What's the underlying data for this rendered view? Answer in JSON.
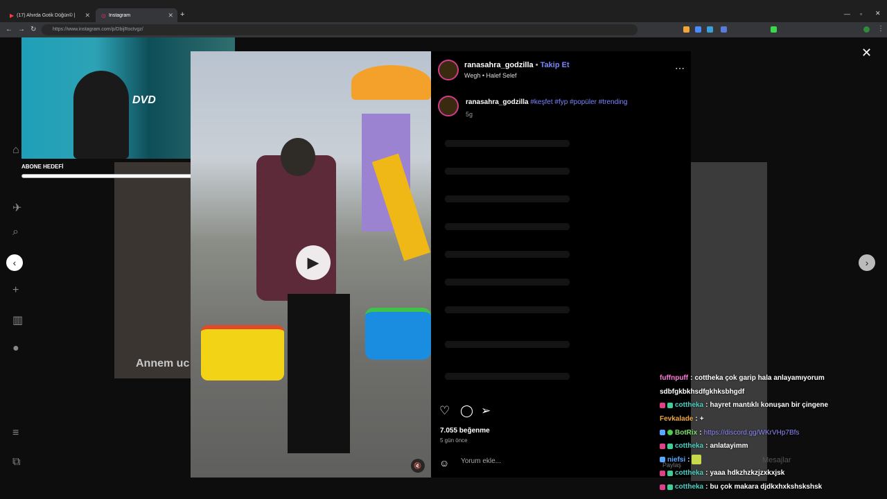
{
  "tabs": [
    {
      "label": "(17) Ahırda Gotik Düğün© |"
    },
    {
      "label": "Instagram"
    }
  ],
  "browser": {
    "url": "https://www.instagram.com/p/DbijRoctvgz/"
  },
  "post": {
    "username": "ranasahra_godzilla",
    "follow_label": "Takip Et",
    "audio": "Wegh • Halef Selef",
    "caption_user": "ranasahra_godzilla",
    "hashtags": "#keşfet #fyp #popüler #trending",
    "caption_age": "5g",
    "likes": "7.055 beğenme",
    "posted": "5 gün önce",
    "comment_placeholder": "Yorum ekle..."
  },
  "background_text": "Annem uc",
  "overlay": {
    "goal_label": "ABONE HEDEFİ"
  },
  "chat": [
    {
      "user": "fuffnpuff",
      "color": "#ff7ad9",
      "msg": "cottheka çok garip hala anlayamıyorum"
    },
    {
      "user": "",
      "color": "#fff",
      "msg": "sdbfgkbkhsdfgkhksbhgdf"
    },
    {
      "user": "cottheka",
      "color": "#4fd1c5",
      "msg": "hayret mantıklı konuşan bir çingene"
    },
    {
      "user": "Fevkalade",
      "color": "#f0a83a",
      "msg": "+"
    },
    {
      "user": "BotRix",
      "color": "#7ee06a",
      "msg": "https://discord.gg/WKrVHp7Bfs",
      "link": true
    },
    {
      "user": "cottheka",
      "color": "#4fd1c5",
      "msg": "anlatayimm"
    },
    {
      "user": "niefsi",
      "color": "#5aa9ff",
      "msg": ""
    },
    {
      "user": "cottheka",
      "color": "#4fd1c5",
      "msg": "yaaa hdkzhzkzjzxkxjsk"
    },
    {
      "user": "cottheka",
      "color": "#4fd1c5",
      "msg": "bu çok makara djdkxhxkshskshsk"
    }
  ],
  "background_labels": {
    "share": "Paylaş",
    "messages": "Mesajlar"
  }
}
